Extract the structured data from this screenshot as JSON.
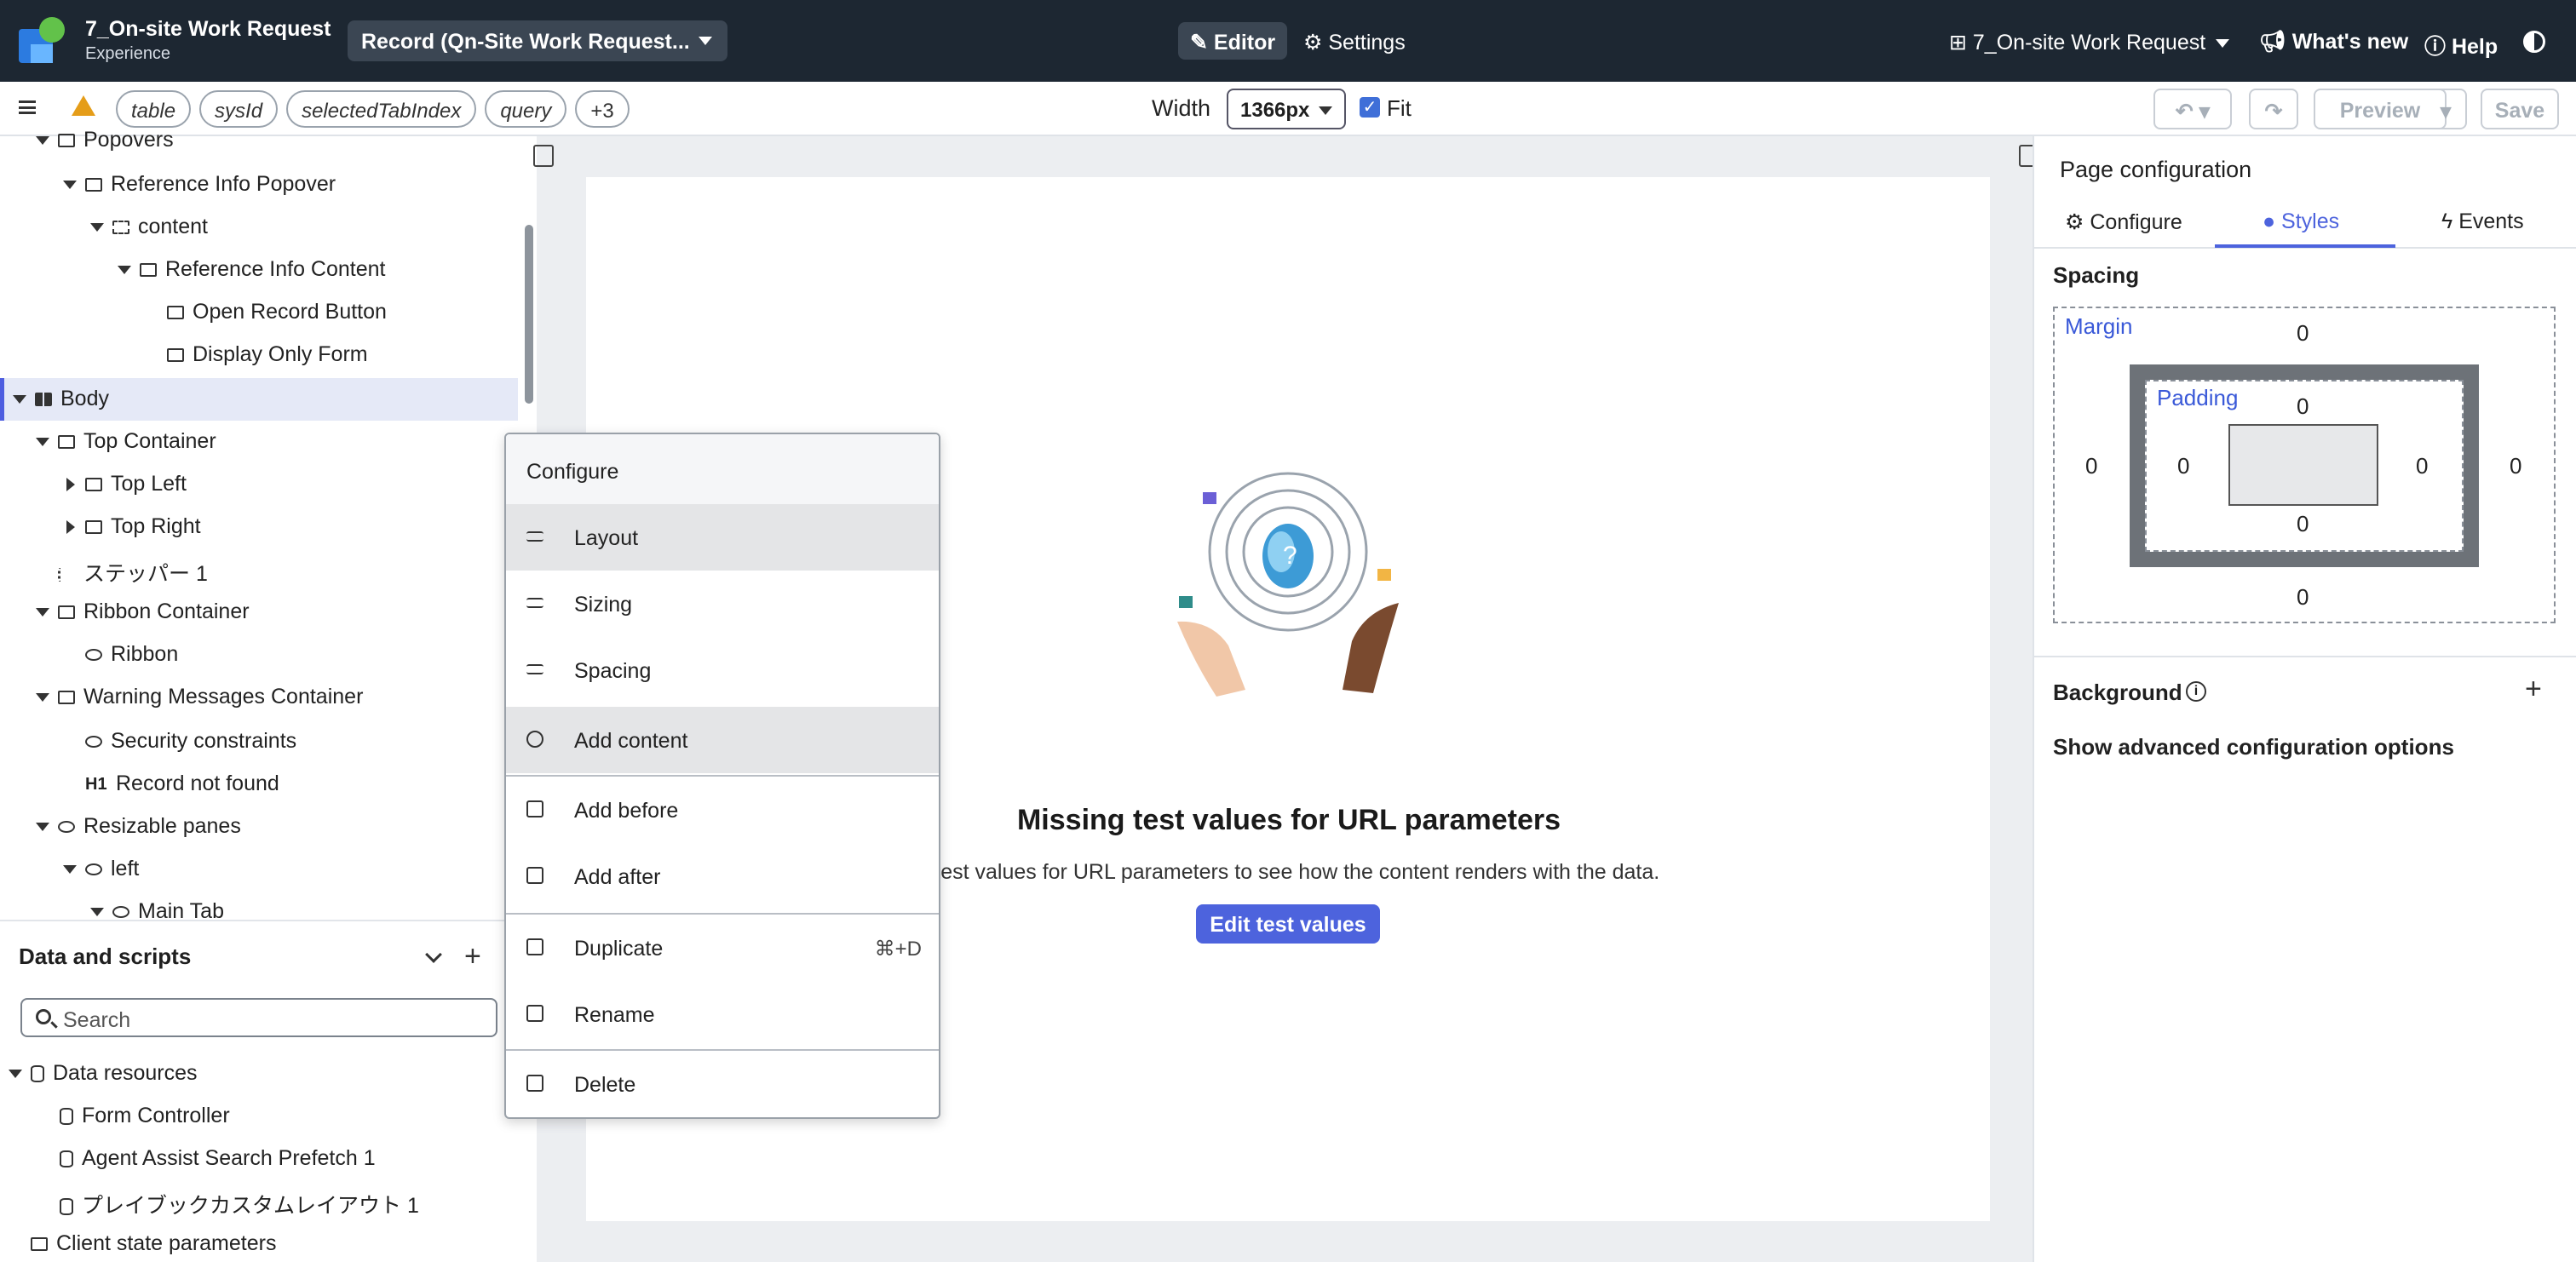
{
  "header": {
    "app_title": "7_On-site Work Request",
    "app_subtitle": "Experience",
    "record_label": "Record (Qn-Site Work Request...",
    "editor_label": "Editor",
    "settings_label": "Settings",
    "nav_context": "7_On-site Work Request",
    "whats_new": "What's new",
    "help": "Help"
  },
  "toolbar": {
    "chips": [
      "table",
      "sysId",
      "selectedTabIndex",
      "query"
    ],
    "more_chip": "+3",
    "width_label": "Width",
    "width_value": "1366px",
    "fit_label": "Fit",
    "fit_checked": true,
    "preview_label": "Preview",
    "save_label": "Save"
  },
  "tree": {
    "items": [
      {
        "label": "Popovers"
      },
      {
        "label": "Reference Info Popover"
      },
      {
        "label": "content"
      },
      {
        "label": "Reference Info Content"
      },
      {
        "label": "Open Record Button"
      },
      {
        "label": "Display Only Form"
      },
      {
        "label": "Body"
      },
      {
        "label": "Top Container"
      },
      {
        "label": "Top Left"
      },
      {
        "label": "Top Right"
      },
      {
        "label": "ステッパー 1"
      },
      {
        "label": "Ribbon Container"
      },
      {
        "label": "Ribbon"
      },
      {
        "label": "Warning Messages Container"
      },
      {
        "label": "Security constraints"
      },
      {
        "label": "Record not found"
      },
      {
        "label": "Resizable panes"
      },
      {
        "label": "left"
      },
      {
        "label": "Main Tab"
      }
    ]
  },
  "data_scripts": {
    "title": "Data and scripts",
    "search_placeholder": "Search",
    "items": [
      {
        "label": "Data resources"
      },
      {
        "label": "Form Controller"
      },
      {
        "label": "Agent Assist Search Prefetch 1"
      },
      {
        "label": "プレイブックカスタムレイアウト 1"
      },
      {
        "label": "Client state parameters"
      }
    ]
  },
  "canvas": {
    "missing_title": "Missing test values for URL parameters",
    "missing_sub": "y test values for URL parameters to see how the content renders with the data.",
    "edit_button": "Edit test values"
  },
  "context_menu": {
    "header": "Configure",
    "items": [
      {
        "label": "Layout",
        "icon": "sliders-icon"
      },
      {
        "label": "Sizing",
        "icon": "sliders-icon"
      },
      {
        "label": "Spacing",
        "icon": "sliders-icon"
      },
      {
        "label": "Add content",
        "icon": "plus-circle-icon"
      },
      {
        "label": "Add before",
        "icon": "insert-before-icon"
      },
      {
        "label": "Add after",
        "icon": "insert-after-icon"
      },
      {
        "label": "Duplicate",
        "icon": "duplicate-icon",
        "shortcut": "⌘+D"
      },
      {
        "label": "Rename",
        "icon": "edit-icon"
      },
      {
        "label": "Delete",
        "icon": "trash-icon"
      }
    ]
  },
  "right_panel": {
    "title": "Page configuration",
    "tabs": [
      {
        "label": "Configure"
      },
      {
        "label": "Styles"
      },
      {
        "label": "Events"
      }
    ],
    "active_tab": "Styles",
    "spacing_label": "Spacing",
    "margin_label": "Margin",
    "padding_label": "Padding",
    "margin": {
      "top": "0",
      "right": "0",
      "bottom": "0",
      "left": "0"
    },
    "padding": {
      "top": "0",
      "right": "0",
      "bottom": "0",
      "left": "0"
    },
    "background_label": "Background",
    "advanced_link": "Show advanced configuration options"
  },
  "colors": {
    "header_bg": "#1d2732",
    "accent": "#4d63dd",
    "warning": "#e59d19"
  }
}
